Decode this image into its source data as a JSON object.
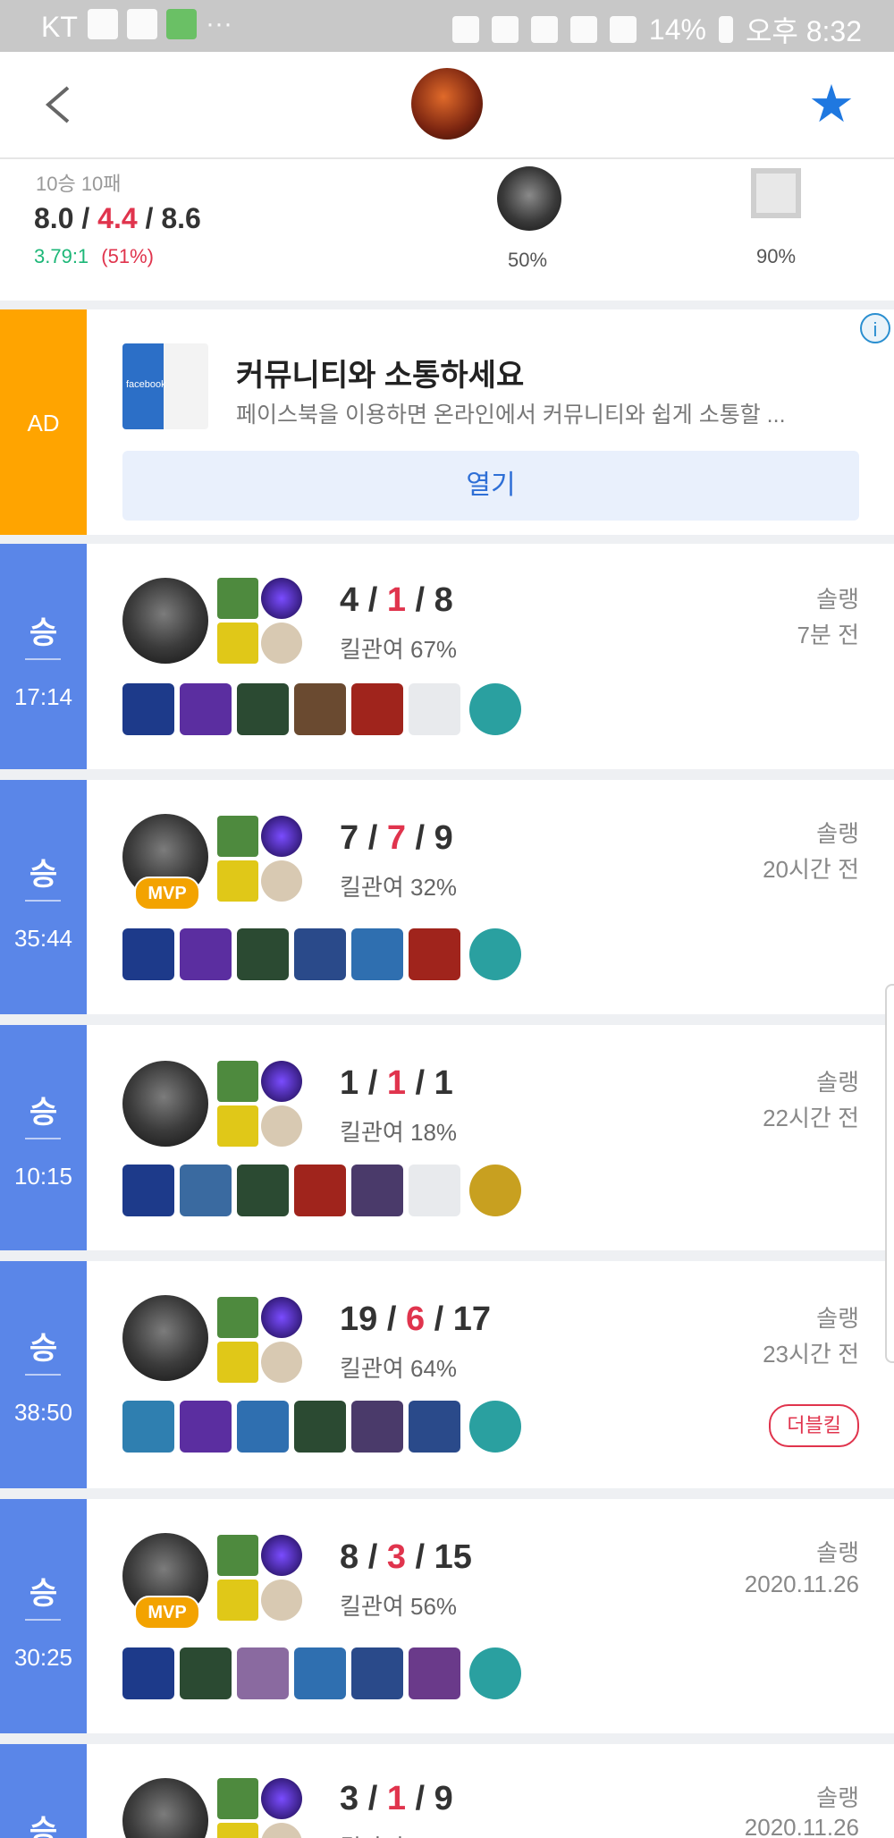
{
  "status_bar": {
    "carrier": "KT",
    "battery": "14%",
    "time": "오후 8:32"
  },
  "summary": {
    "record": "10승 10패",
    "kills": "8.0",
    "deaths": "4.4",
    "assists": "8.6",
    "kda_ratio": "3.79:1",
    "kill_participation": "(51%)",
    "champion_rate": "50%",
    "position_rate": "90%"
  },
  "ad": {
    "label": "AD",
    "logo_text": "facebook",
    "title": "커뮤니티와 소통하세요",
    "description": "페이스북을 이용하면 온라인에서 커뮤니티와 쉽게 소통할 ...",
    "button": "열기",
    "info": "i"
  },
  "matches": [
    {
      "result": "승",
      "duration": "17:14",
      "kills": "4",
      "deaths": "1",
      "assists": "8",
      "kp": "킬관여 67%",
      "queue": "솔랭",
      "ago": "7분 전",
      "mvp": "",
      "badge": ""
    },
    {
      "result": "승",
      "duration": "35:44",
      "kills": "7",
      "deaths": "7",
      "assists": "9",
      "kp": "킬관여 32%",
      "queue": "솔랭",
      "ago": "20시간 전",
      "mvp": "MVP",
      "badge": ""
    },
    {
      "result": "승",
      "duration": "10:15",
      "kills": "1",
      "deaths": "1",
      "assists": "1",
      "kp": "킬관여 18%",
      "queue": "솔랭",
      "ago": "22시간 전",
      "mvp": "",
      "badge": ""
    },
    {
      "result": "승",
      "duration": "38:50",
      "kills": "19",
      "deaths": "6",
      "assists": "17",
      "kp": "킬관여 64%",
      "queue": "솔랭",
      "ago": "23시간 전",
      "mvp": "",
      "badge": "더블킬"
    },
    {
      "result": "승",
      "duration": "30:25",
      "kills": "8",
      "deaths": "3",
      "assists": "15",
      "kp": "킬관여 56%",
      "queue": "솔랭",
      "ago": "2020.11.26",
      "mvp": "MVP",
      "badge": ""
    },
    {
      "result": "승",
      "duration": "",
      "kills": "3",
      "deaths": "1",
      "assists": "9",
      "kp": "킬관여",
      "queue": "솔랭",
      "ago": "2020.11.26",
      "mvp": "",
      "badge": ""
    }
  ],
  "icons": [
    "back-arrow-icon",
    "star-icon",
    "info-icon",
    "position-icon"
  ],
  "colors": {
    "win": "#5a86e8",
    "ad": "#ffa400",
    "death": "#e0344d",
    "ratio": "#1db778",
    "accent": "#1f78e0"
  }
}
